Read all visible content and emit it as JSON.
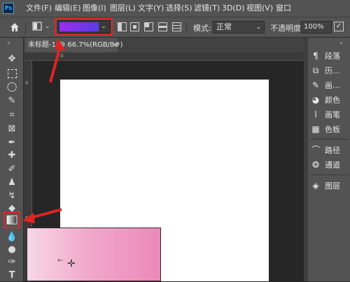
{
  "app": {
    "logo_text": "Ps"
  },
  "menu": {
    "items": [
      {
        "label": "文件(F)"
      },
      {
        "label": "编辑(E)"
      },
      {
        "label": "图像(I)"
      },
      {
        "label": "图层(L)"
      },
      {
        "label": "文字(Y)"
      },
      {
        "label": "选择(S)"
      },
      {
        "label": "滤镜(T)"
      },
      {
        "label": "3D(D)"
      },
      {
        "label": "视图(V)"
      },
      {
        "label": "窗口"
      }
    ]
  },
  "options": {
    "gradient_colors": [
      "#9b2cf5",
      "#5a3ce8"
    ],
    "mode_label": "模式:",
    "mode_value": "正常",
    "opacity_label": "不透明度:",
    "opacity_value": "100%"
  },
  "document": {
    "tab_title": "未标题-1 @ 66.7%(RGB/8#)",
    "close_glyph": "×",
    "ruler_top_labels": [
      "0"
    ],
    "ruler_left_labels": [
      "0",
      "5"
    ]
  },
  "panels": {
    "items": [
      {
        "label": "段落",
        "icon": "paragraph-icon"
      },
      {
        "label": "历...",
        "icon": "history-icon"
      },
      {
        "label": "画...",
        "icon": "brush-settings-icon"
      },
      {
        "label": "颜色",
        "icon": "color-icon"
      },
      {
        "label": "画笔",
        "icon": "brushes-icon"
      },
      {
        "label": "色板",
        "icon": "swatches-icon"
      },
      {
        "label": "路径",
        "icon": "paths-icon"
      },
      {
        "label": "通道",
        "icon": "channels-icon"
      },
      {
        "label": "图层",
        "icon": "layers-icon"
      }
    ]
  },
  "annotation_color": "#e02424"
}
